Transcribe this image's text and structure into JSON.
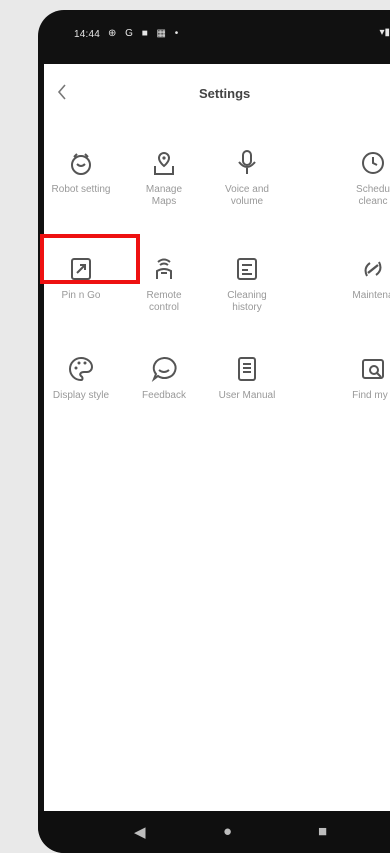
{
  "status": {
    "time": "14:44",
    "left_icons": "⊕ G ■ ▦ •",
    "right_icons": "▾▮"
  },
  "header": {
    "back_icon": "chevron-left-icon",
    "title": "Settings"
  },
  "grid": [
    {
      "label": "Robot setting",
      "icon": "robot-icon"
    },
    {
      "label": "Manage\nMaps",
      "icon": "map-icon"
    },
    {
      "label": "Voice and\nvolume",
      "icon": "microphone-icon"
    },
    {
      "label": "Schedu\ncleanc",
      "icon": "clock-icon"
    },
    {
      "label": "Pin n Go",
      "icon": "pin-go-icon"
    },
    {
      "label": "Remote\ncontrol",
      "icon": "remote-control-icon"
    },
    {
      "label": "Cleaning\nhistory",
      "icon": "history-icon"
    },
    {
      "label": "Maintena",
      "icon": "maintenance-icon"
    },
    {
      "label": "Display style",
      "icon": "palette-icon"
    },
    {
      "label": "Feedback",
      "icon": "chat-bubble-icon"
    },
    {
      "label": "User Manual",
      "icon": "manual-icon"
    },
    {
      "label": "Find my r",
      "icon": "find-robot-icon"
    }
  ],
  "nav": {
    "back": "◀",
    "home": "●",
    "recents": "■"
  },
  "colors": {
    "highlight": "#ee1111",
    "label": "#999999",
    "icon": "#555555"
  }
}
